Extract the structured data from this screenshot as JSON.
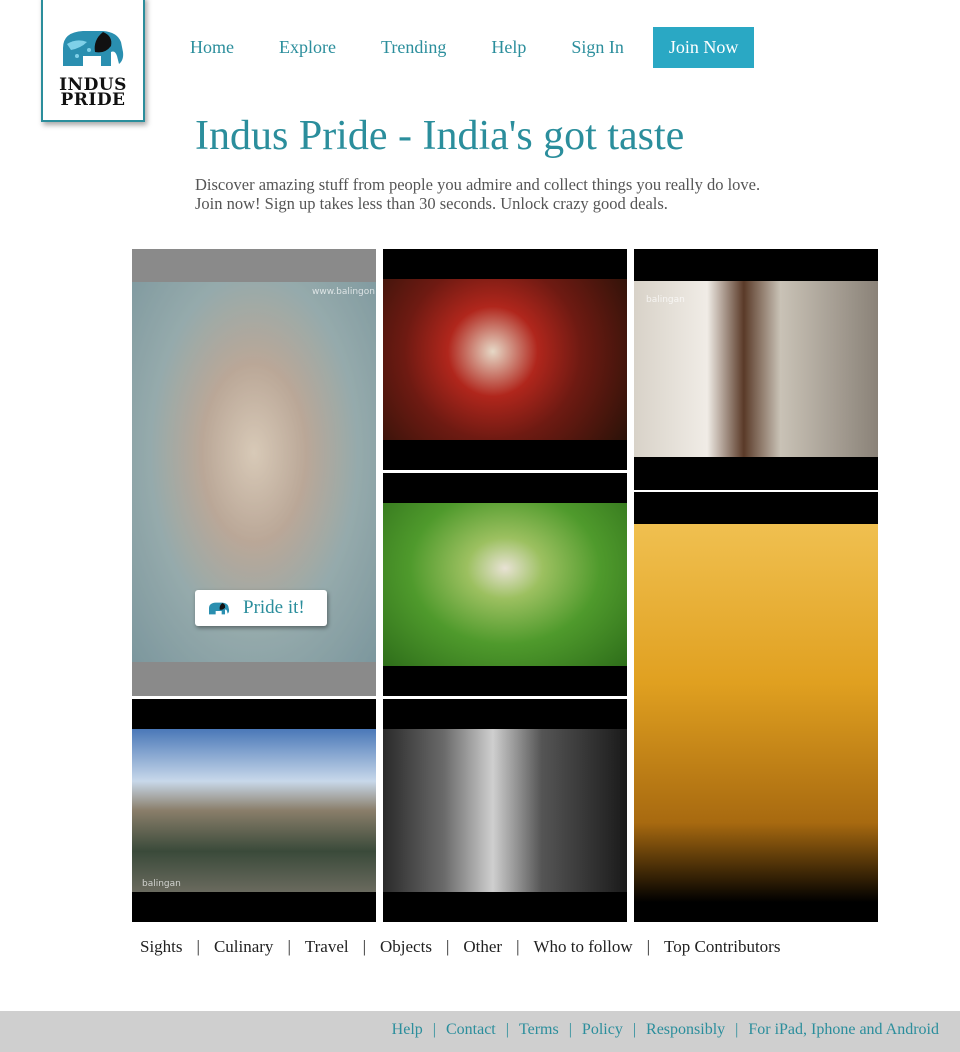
{
  "logo": {
    "line1": "INDUS",
    "line2": "PRIDE",
    "icon": "elephant-icon"
  },
  "nav": {
    "items": [
      "Home",
      "Explore",
      "Trending",
      "Help",
      "Sign In"
    ],
    "join_label": "Join Now"
  },
  "hero": {
    "title": "Indus Pride - India's got taste",
    "subtitle_line1": "Discover amazing stuff from people you admire and collect things you really do love.",
    "subtitle_line2": "Join now! Sign up takes less than 30 seconds. Unlock crazy good deals."
  },
  "tiles": {
    "pride_label": "Pride it!",
    "watermarks": [
      "www.balingon",
      "balingan",
      "balingan"
    ]
  },
  "categories": [
    "Sights",
    "Culinary",
    "Travel",
    "Objects",
    "Other",
    "Who to follow",
    "Top Contributors"
  ],
  "footer": {
    "links": [
      "Help",
      "Contact",
      "Terms",
      "Policy",
      "Responsibly",
      "For iPad, Iphone and Android"
    ]
  },
  "colors": {
    "accent": "#2b8e9c",
    "button": "#2aa8c4",
    "footer_bg": "#cfcfcf"
  }
}
